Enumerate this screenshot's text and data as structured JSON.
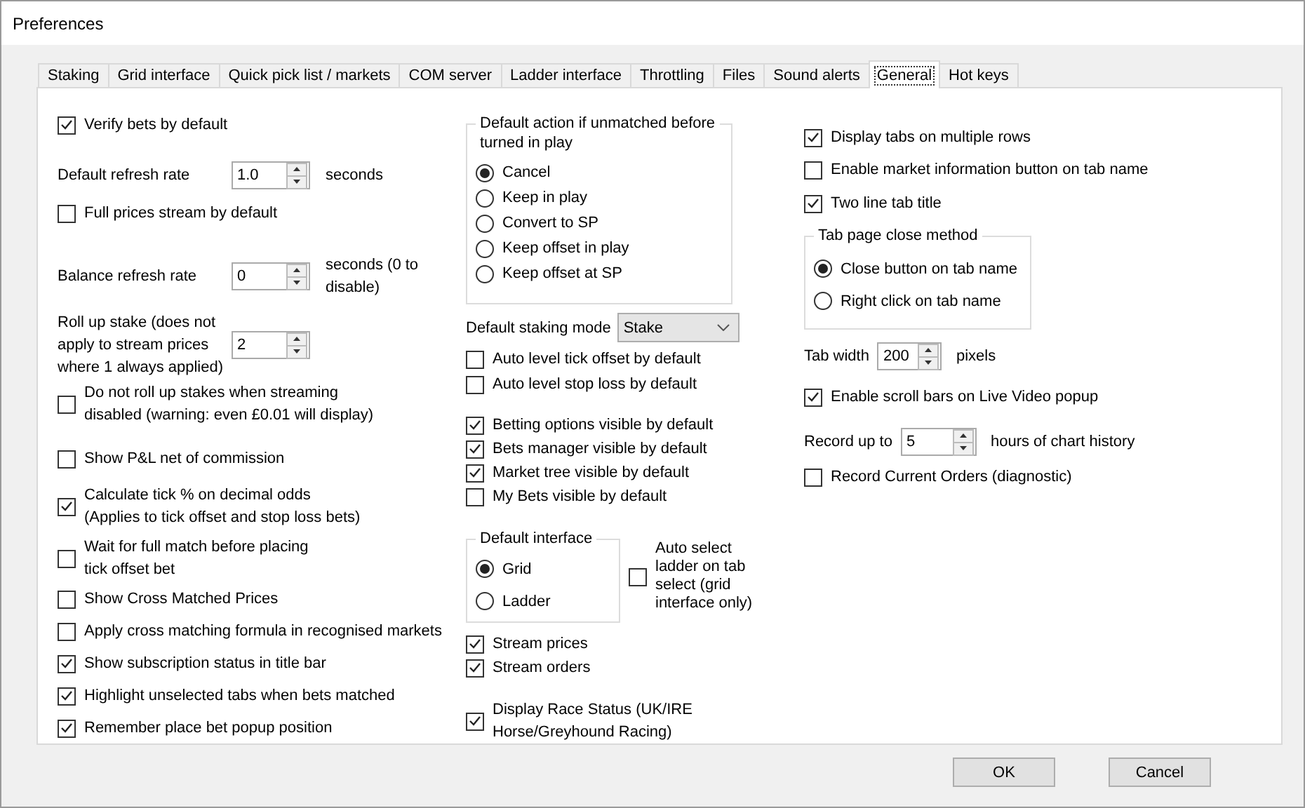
{
  "window": {
    "title": "Preferences"
  },
  "tabs": [
    {
      "label": "Staking",
      "selected": false
    },
    {
      "label": "Grid interface",
      "selected": false
    },
    {
      "label": "Quick pick list / markets",
      "selected": false
    },
    {
      "label": "COM server",
      "selected": false
    },
    {
      "label": "Ladder interface",
      "selected": false
    },
    {
      "label": "Throttling",
      "selected": false
    },
    {
      "label": "Files",
      "selected": false
    },
    {
      "label": "Sound alerts",
      "selected": false
    },
    {
      "label": "General",
      "selected": true
    },
    {
      "label": "Hot keys",
      "selected": false
    }
  ],
  "left": [
    {
      "kind": "checkbox",
      "label": "Verify bets by default",
      "checked": true
    },
    {
      "kind": "spinner",
      "label": "Default refresh rate",
      "value": "1.0",
      "unit": "seconds"
    },
    {
      "kind": "checkbox",
      "label": "Full prices stream by default",
      "checked": false
    },
    {
      "kind": "spinner",
      "label": "Balance refresh rate",
      "value": "0",
      "unit": "seconds (0 to\ndisable)"
    },
    {
      "kind": "spinner",
      "label": "Roll up stake (does not\napply to stream prices\nwhere 1 always applied)",
      "value": "2"
    },
    {
      "kind": "checkbox",
      "label": "Do not roll up stakes when streaming\ndisabled (warning: even £0.01 will display)",
      "checked": false
    },
    {
      "kind": "checkbox",
      "label": "Show P&L net of commission",
      "checked": false
    },
    {
      "kind": "checkbox",
      "label": "Calculate tick % on decimal odds\n(Applies to tick offset and stop loss bets)",
      "checked": true
    },
    {
      "kind": "checkbox",
      "label": "Wait for full match before placing\ntick offset bet",
      "checked": false
    },
    {
      "kind": "checkbox",
      "label": "Show Cross Matched Prices",
      "checked": false
    },
    {
      "kind": "checkbox",
      "label": "Apply cross matching formula in recognised markets",
      "checked": false
    },
    {
      "kind": "checkbox",
      "label": "Show subscription status in title bar",
      "checked": true
    },
    {
      "kind": "checkbox",
      "label": "Highlight unselected tabs when bets matched",
      "checked": true
    },
    {
      "kind": "checkbox",
      "label": "Remember place bet popup position",
      "checked": true
    }
  ],
  "middle": [
    {
      "kind": "radio_group",
      "title": "Default action if unmatched before\nturned in play",
      "options": [
        {
          "label": "Cancel",
          "selected": true
        },
        {
          "label": "Keep in play",
          "selected": false
        },
        {
          "label": "Convert to SP",
          "selected": false
        },
        {
          "label": "Keep offset in play",
          "selected": false
        },
        {
          "label": "Keep offset at SP",
          "selected": false
        }
      ]
    },
    {
      "kind": "dropdown",
      "label": "Default staking mode",
      "value": "Stake"
    },
    {
      "kind": "checkbox",
      "label": "Auto level tick offset by default",
      "checked": false
    },
    {
      "kind": "checkbox",
      "label": "Auto level stop loss by default",
      "checked": false
    },
    {
      "kind": "checkbox",
      "label": "Betting options visible by default",
      "checked": true
    },
    {
      "kind": "checkbox",
      "label": "Bets manager visible by default",
      "checked": true
    },
    {
      "kind": "checkbox",
      "label": "Market tree visible by default",
      "checked": true
    },
    {
      "kind": "checkbox",
      "label": "My Bets visible by default",
      "checked": false
    },
    {
      "kind": "group_row",
      "group": {
        "title": "Default interface",
        "options": [
          {
            "label": "Grid",
            "selected": true
          },
          {
            "label": "Ladder",
            "selected": false
          }
        ]
      },
      "checkbox": {
        "label": "Auto select\nladder on tab\nselect (grid\ninterface only)",
        "checked": false
      }
    },
    {
      "kind": "checkbox",
      "label": "Stream prices",
      "checked": true
    },
    {
      "kind": "checkbox",
      "label": "Stream orders",
      "checked": true
    },
    {
      "kind": "checkbox",
      "label": "Display Race Status (UK/IRE\nHorse/Greyhound Racing)",
      "checked": true
    }
  ],
  "right": [
    {
      "kind": "checkbox",
      "label": "Display tabs on multiple rows",
      "checked": true
    },
    {
      "kind": "checkbox",
      "label": "Enable market information button on tab name",
      "checked": false
    },
    {
      "kind": "checkbox",
      "label": "Two line tab title",
      "checked": true
    },
    {
      "kind": "radio_group",
      "title": "Tab page close method",
      "options": [
        {
          "label": "Close button on tab name",
          "selected": true
        },
        {
          "label": "Right click on tab name",
          "selected": false
        }
      ]
    },
    {
      "kind": "spinner",
      "label": "Tab width",
      "value": "200",
      "unit": "pixels"
    },
    {
      "kind": "checkbox",
      "label": "Enable scroll bars on Live Video popup",
      "checked": true
    },
    {
      "kind": "spinner",
      "label": "Record up to",
      "value": "5",
      "unit": "hours of chart history"
    },
    {
      "kind": "checkbox",
      "label": "Record Current Orders (diagnostic)",
      "checked": false
    }
  ],
  "buttons": [
    "OK",
    "Cancel"
  ]
}
